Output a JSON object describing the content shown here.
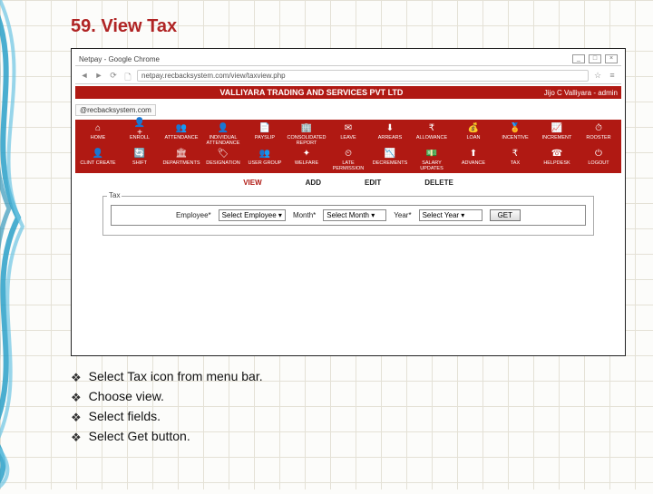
{
  "title": "59. View Tax",
  "browser": {
    "window_title": "Netpay - Google Chrome",
    "url": "netpay.recbacksystem.com/view/taxview.php"
  },
  "app": {
    "company": "VALLIYARA TRADING AND SERVICES PVT LTD",
    "user": "Jijo C Valliyara - admin",
    "email": "@recbacksystem.com"
  },
  "menu_row1": [
    {
      "label": "HOME",
      "icon": "⌂"
    },
    {
      "label": "ENROLL",
      "icon": "👤+"
    },
    {
      "label": "ATTENDANCE",
      "icon": "👥"
    },
    {
      "label": "INDIVIDUAL ATTENDANCE",
      "icon": "👤"
    },
    {
      "label": "PAYSLIP",
      "icon": "📄"
    },
    {
      "label": "CONSOLIDATED REPORT",
      "icon": "🏢"
    },
    {
      "label": "LEAVE",
      "icon": "✉"
    },
    {
      "label": "ARREARS",
      "icon": "⬇"
    },
    {
      "label": "ALLOWANCE",
      "icon": "₹"
    },
    {
      "label": "LOAN",
      "icon": "💰"
    },
    {
      "label": "INCENTIVE",
      "icon": "🏅"
    },
    {
      "label": "INCREMENT",
      "icon": "📈"
    },
    {
      "label": "ROOSTER",
      "icon": "⏱"
    }
  ],
  "menu_row2": [
    {
      "label": "CLINT CREATE",
      "icon": "👤"
    },
    {
      "label": "SHIFT",
      "icon": "🔄"
    },
    {
      "label": "DEPARTMENTS",
      "icon": "🏛"
    },
    {
      "label": "DESIGNATION",
      "icon": "🏷"
    },
    {
      "label": "USER GROUP",
      "icon": "👥"
    },
    {
      "label": "WELFARE",
      "icon": "✦"
    },
    {
      "label": "LATE PERMISSION",
      "icon": "⏲"
    },
    {
      "label": "DECREMENTS",
      "icon": "📉"
    },
    {
      "label": "SALARY UPDATES",
      "icon": "💵"
    },
    {
      "label": "ADVANCE",
      "icon": "⬆"
    },
    {
      "label": "TAX",
      "icon": "₹"
    },
    {
      "label": "HELPDESK",
      "icon": "☎"
    },
    {
      "label": "LOGOUT",
      "icon": "⏻"
    }
  ],
  "tabs": {
    "view": "VIEW",
    "add": "ADD",
    "edit": "EDIT",
    "delete": "DELETE"
  },
  "form": {
    "section_label": "Tax",
    "employee_label": "Employee*",
    "employee_value": "Select Employee",
    "month_label": "Month*",
    "month_value": "Select Month",
    "year_label": "Year*",
    "year_value": "Select Year",
    "get_label": "GET"
  },
  "instructions": [
    "Select Tax icon from menu bar.",
    "Choose view.",
    "Select fields.",
    "Select Get button."
  ]
}
